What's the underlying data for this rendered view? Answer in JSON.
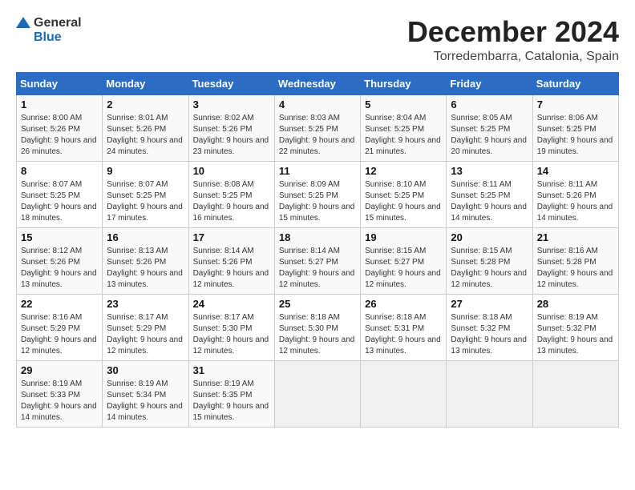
{
  "header": {
    "logo_general": "General",
    "logo_blue": "Blue",
    "title": "December 2024",
    "subtitle": "Torredembarra, Catalonia, Spain"
  },
  "weekdays": [
    "Sunday",
    "Monday",
    "Tuesday",
    "Wednesday",
    "Thursday",
    "Friday",
    "Saturday"
  ],
  "weeks": [
    [
      {
        "day": "1",
        "sunrise": "8:00 AM",
        "sunset": "5:26 PM",
        "daylight": "9 hours and 26 minutes."
      },
      {
        "day": "2",
        "sunrise": "8:01 AM",
        "sunset": "5:26 PM",
        "daylight": "9 hours and 24 minutes."
      },
      {
        "day": "3",
        "sunrise": "8:02 AM",
        "sunset": "5:26 PM",
        "daylight": "9 hours and 23 minutes."
      },
      {
        "day": "4",
        "sunrise": "8:03 AM",
        "sunset": "5:25 PM",
        "daylight": "9 hours and 22 minutes."
      },
      {
        "day": "5",
        "sunrise": "8:04 AM",
        "sunset": "5:25 PM",
        "daylight": "9 hours and 21 minutes."
      },
      {
        "day": "6",
        "sunrise": "8:05 AM",
        "sunset": "5:25 PM",
        "daylight": "9 hours and 20 minutes."
      },
      {
        "day": "7",
        "sunrise": "8:06 AM",
        "sunset": "5:25 PM",
        "daylight": "9 hours and 19 minutes."
      }
    ],
    [
      {
        "day": "8",
        "sunrise": "8:07 AM",
        "sunset": "5:25 PM",
        "daylight": "9 hours and 18 minutes."
      },
      {
        "day": "9",
        "sunrise": "8:07 AM",
        "sunset": "5:25 PM",
        "daylight": "9 hours and 17 minutes."
      },
      {
        "day": "10",
        "sunrise": "8:08 AM",
        "sunset": "5:25 PM",
        "daylight": "9 hours and 16 minutes."
      },
      {
        "day": "11",
        "sunrise": "8:09 AM",
        "sunset": "5:25 PM",
        "daylight": "9 hours and 15 minutes."
      },
      {
        "day": "12",
        "sunrise": "8:10 AM",
        "sunset": "5:25 PM",
        "daylight": "9 hours and 15 minutes."
      },
      {
        "day": "13",
        "sunrise": "8:11 AM",
        "sunset": "5:25 PM",
        "daylight": "9 hours and 14 minutes."
      },
      {
        "day": "14",
        "sunrise": "8:11 AM",
        "sunset": "5:26 PM",
        "daylight": "9 hours and 14 minutes."
      }
    ],
    [
      {
        "day": "15",
        "sunrise": "8:12 AM",
        "sunset": "5:26 PM",
        "daylight": "9 hours and 13 minutes."
      },
      {
        "day": "16",
        "sunrise": "8:13 AM",
        "sunset": "5:26 PM",
        "daylight": "9 hours and 13 minutes."
      },
      {
        "day": "17",
        "sunrise": "8:14 AM",
        "sunset": "5:26 PM",
        "daylight": "9 hours and 12 minutes."
      },
      {
        "day": "18",
        "sunrise": "8:14 AM",
        "sunset": "5:27 PM",
        "daylight": "9 hours and 12 minutes."
      },
      {
        "day": "19",
        "sunrise": "8:15 AM",
        "sunset": "5:27 PM",
        "daylight": "9 hours and 12 minutes."
      },
      {
        "day": "20",
        "sunrise": "8:15 AM",
        "sunset": "5:28 PM",
        "daylight": "9 hours and 12 minutes."
      },
      {
        "day": "21",
        "sunrise": "8:16 AM",
        "sunset": "5:28 PM",
        "daylight": "9 hours and 12 minutes."
      }
    ],
    [
      {
        "day": "22",
        "sunrise": "8:16 AM",
        "sunset": "5:29 PM",
        "daylight": "9 hours and 12 minutes."
      },
      {
        "day": "23",
        "sunrise": "8:17 AM",
        "sunset": "5:29 PM",
        "daylight": "9 hours and 12 minutes."
      },
      {
        "day": "24",
        "sunrise": "8:17 AM",
        "sunset": "5:30 PM",
        "daylight": "9 hours and 12 minutes."
      },
      {
        "day": "25",
        "sunrise": "8:18 AM",
        "sunset": "5:30 PM",
        "daylight": "9 hours and 12 minutes."
      },
      {
        "day": "26",
        "sunrise": "8:18 AM",
        "sunset": "5:31 PM",
        "daylight": "9 hours and 13 minutes."
      },
      {
        "day": "27",
        "sunrise": "8:18 AM",
        "sunset": "5:32 PM",
        "daylight": "9 hours and 13 minutes."
      },
      {
        "day": "28",
        "sunrise": "8:19 AM",
        "sunset": "5:32 PM",
        "daylight": "9 hours and 13 minutes."
      }
    ],
    [
      {
        "day": "29",
        "sunrise": "8:19 AM",
        "sunset": "5:33 PM",
        "daylight": "9 hours and 14 minutes."
      },
      {
        "day": "30",
        "sunrise": "8:19 AM",
        "sunset": "5:34 PM",
        "daylight": "9 hours and 14 minutes."
      },
      {
        "day": "31",
        "sunrise": "8:19 AM",
        "sunset": "5:35 PM",
        "daylight": "9 hours and 15 minutes."
      },
      null,
      null,
      null,
      null
    ]
  ],
  "labels": {
    "sunrise": "Sunrise:",
    "sunset": "Sunset:",
    "daylight": "Daylight:"
  }
}
